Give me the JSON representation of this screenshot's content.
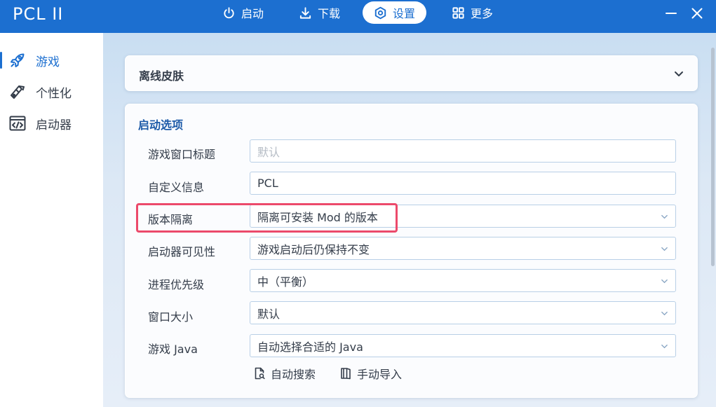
{
  "app": {
    "title": "PCL II"
  },
  "nav": {
    "launch": {
      "label": "启动",
      "icon": "power-icon"
    },
    "download": {
      "label": "下载",
      "icon": "download-icon"
    },
    "settings": {
      "label": "设置",
      "icon": "settings-hexagon-icon",
      "active": true
    },
    "more": {
      "label": "更多",
      "icon": "grid-icon"
    }
  },
  "window": {
    "minimize_icon": "minimize-icon",
    "close_icon": "close-icon"
  },
  "sidebar": {
    "items": [
      {
        "label": "游戏",
        "icon": "rocket-icon",
        "active": true
      },
      {
        "label": "个性化",
        "icon": "palette-icon",
        "active": false
      },
      {
        "label": "启动器",
        "icon": "code-window-icon",
        "active": false
      }
    ]
  },
  "cards": {
    "offline_skin": {
      "title": "离线皮肤",
      "collapsed": true
    },
    "launch_options": {
      "title": "启动选项",
      "rows": [
        {
          "label": "游戏窗口标题",
          "value": "",
          "placeholder": "默认",
          "type": "text"
        },
        {
          "label": "自定义信息",
          "value": "PCL",
          "type": "text"
        },
        {
          "label": "版本隔离",
          "value": "隔离可安装 Mod 的版本",
          "type": "select"
        },
        {
          "label": "启动器可见性",
          "value": "游戏启动后仍保持不变",
          "type": "select"
        },
        {
          "label": "进程优先级",
          "value": "中（平衡）",
          "type": "select"
        },
        {
          "label": "窗口大小",
          "value": "默认",
          "type": "select"
        },
        {
          "label": "游戏 Java",
          "value": "自动选择合适的 Java",
          "type": "select"
        }
      ],
      "actions": {
        "auto_search": "自动搜索",
        "manual_import": "手动导入"
      }
    }
  },
  "colors": {
    "accent": "#1c6fd0",
    "highlight": "#ec4a6b"
  }
}
